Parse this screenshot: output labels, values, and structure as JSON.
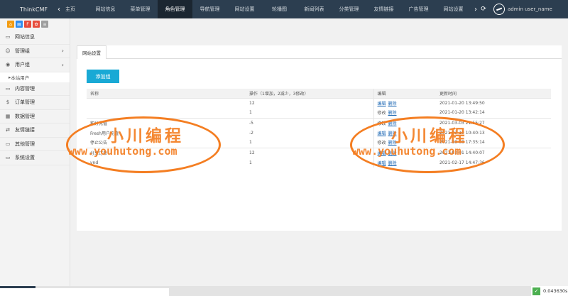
{
  "app": {
    "brand": "ThinkCMF"
  },
  "topbar": {
    "home_label": "主页",
    "tabs": [
      "网站信息",
      "菜单管理",
      "角色管理",
      "导航管理",
      "网站设置",
      "轮播图",
      "新闻列表",
      "分类管理",
      "友情链接",
      "广告管理",
      "网站设置"
    ],
    "active_index": 2,
    "user_name": "admin user_name"
  },
  "sidebar": {
    "quick_icons": [
      {
        "name": "home-icon",
        "glyph": "⌂",
        "color": "#f39c12"
      },
      {
        "name": "doc-icon",
        "glyph": "▤",
        "color": "#2d8cf0"
      },
      {
        "name": "flag-icon",
        "glyph": "F",
        "color": "#e74c3c"
      },
      {
        "name": "gear-icon",
        "glyph": "✿",
        "color": "#e74c3c"
      },
      {
        "name": "list-icon",
        "glyph": "≡",
        "color": "#9e9e9e"
      }
    ],
    "items": [
      {
        "label": "网站信息",
        "icon": "monitor-icon",
        "glyph": "▭",
        "arrow": false
      },
      {
        "label": "管理组",
        "icon": "users-icon",
        "glyph": "☺",
        "arrow": true
      },
      {
        "label": "用户组",
        "icon": "user-icon",
        "glyph": "◉",
        "arrow": true
      },
      {
        "label": "本站用户",
        "sub": true
      },
      {
        "label": "内容管理",
        "icon": "monitor-icon",
        "glyph": "▭",
        "arrow": false
      },
      {
        "label": "订单管理",
        "icon": "dollar-icon",
        "glyph": "$",
        "arrow": false
      },
      {
        "label": "数据管理",
        "icon": "chart-icon",
        "glyph": "▦",
        "arrow": false
      },
      {
        "label": "友情链接",
        "icon": "exchange-icon",
        "glyph": "⇄",
        "arrow": false
      },
      {
        "label": "其他管理",
        "icon": "monitor-icon",
        "glyph": "▭",
        "arrow": false
      },
      {
        "label": "系统设置",
        "icon": "monitor-icon",
        "glyph": "▭",
        "arrow": false
      }
    ]
  },
  "main": {
    "tab_label": "网站设置",
    "add_button": "添加组",
    "table": {
      "headers": [
        "名称",
        "操作（1增加，2减少，3修改）",
        "编辑",
        "更新时间"
      ],
      "rows": [
        {
          "name": "",
          "op": "12",
          "actions": [
            "编辑",
            "删除"
          ],
          "time": "2021-01-20 13:49:50",
          "first": true
        },
        {
          "name": "",
          "op": "1",
          "actions": [
            "修改",
            "删除"
          ],
          "time": "2021-01-20 13:42:14",
          "first": false
        },
        {
          "name": "积分充值",
          "op": "-5",
          "actions": [
            "修改",
            "删除"
          ],
          "time": "2021-03-03 21:55:27",
          "first": true
        },
        {
          "name": "Fresh用户充值",
          "op": "-2",
          "actions": [
            "编辑",
            "删除"
          ],
          "time": "2021-03-10 10:40:13",
          "first": false
        },
        {
          "name": "停止公告",
          "op": "1",
          "actions": [
            "修改",
            "删除"
          ],
          "time": "2021-03-03 17:35:14",
          "first": false
        },
        {
          "name": "分享订单",
          "op": "12",
          "actions": [
            "编辑",
            "删除"
          ],
          "time": "2021-03-01 14:40:07",
          "first": true
        },
        {
          "name": "vnd",
          "op": "1",
          "actions": [
            "编辑",
            "删除"
          ],
          "time": "2021-02-17 14:47:36",
          "first": false
        }
      ]
    }
  },
  "watermark": {
    "cn": "小川编程",
    "url": "www.youhutong.com"
  },
  "status": {
    "timer": "0.043630s"
  }
}
